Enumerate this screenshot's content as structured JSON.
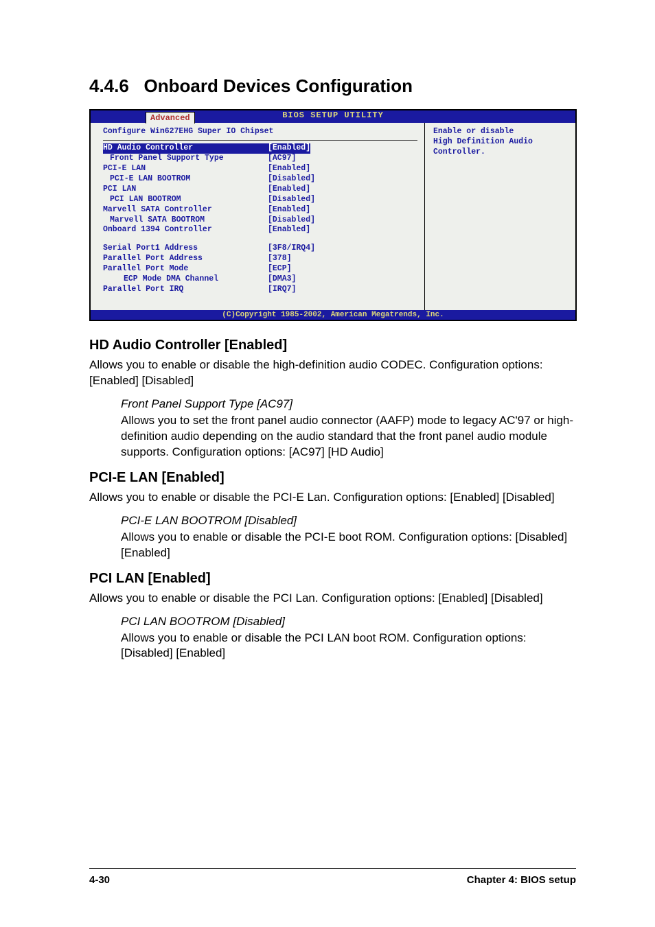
{
  "sectionNumber": "4.4.6",
  "sectionTitle": "Onboard Devices Configuration",
  "bios": {
    "headerTitle": "BIOS SETUP UTILITY",
    "tab": "Advanced",
    "chipsetLine": "Configure Win627EHG Super IO Chipset",
    "help1": "Enable or disable",
    "help2": "High Definition Audio Controller.",
    "rows": [
      {
        "label": "HD Audio Controller",
        "val": "[Enabled]",
        "sel": true
      },
      {
        "label": "Front Panel Support Type",
        "val": "[AC97]",
        "indent": 1
      },
      {
        "label": "PCI-E LAN",
        "val": "[Enabled]"
      },
      {
        "label": "PCI-E LAN BOOTROM",
        "val": "[Disabled]",
        "indent": 1
      },
      {
        "label": "PCI LAN",
        "val": "[Enabled]"
      },
      {
        "label": "PCI LAN BOOTROM",
        "val": "[Disabled]",
        "indent": 1
      },
      {
        "label": "Marvell SATA Controller",
        "val": "[Enabled]"
      },
      {
        "label": "Marvell SATA BOOTROM",
        "val": "[Disabled]",
        "indent": 1
      },
      {
        "label": "Onboard 1394 Controller",
        "val": "[Enabled]"
      }
    ],
    "rows2": [
      {
        "label": "Serial Port1 Address",
        "val": "[3F8/IRQ4]"
      },
      {
        "label": "Parallel Port Address",
        "val": "[378]"
      },
      {
        "label": "Parallel Port Mode",
        "val": "[ECP]"
      },
      {
        "label": "ECP Mode DMA Channel",
        "val": "[DMA3]",
        "indent": 2
      },
      {
        "label": "Parallel Port IRQ",
        "val": "[IRQ7]"
      }
    ],
    "footer": "(C)Copyright 1985-2002, American Megatrends, Inc."
  },
  "sections": [
    {
      "heading": "HD Audio Controller [Enabled]",
      "body": "Allows you to enable or disable the high-definition audio CODEC. Configuration options: [Enabled] [Disabled]",
      "sub": {
        "title": "Front Panel Support Type [AC97]",
        "body": "Allows you to set the front panel audio connector (AAFP) mode to legacy AC'97 or high-definition audio depending on the audio standard that the front panel audio module supports. Configuration options: [AC97] [HD Audio]"
      }
    },
    {
      "heading": "PCI-E LAN [Enabled]",
      "body": "Allows you to enable or disable the PCI-E Lan. Configuration options: [Enabled] [Disabled]",
      "sub": {
        "title": "PCI-E LAN BOOTROM [Disabled]",
        "body": "Allows you to enable or disable the PCI-E boot ROM. Configuration options: [Disabled] [Enabled]"
      }
    },
    {
      "heading": "PCI LAN [Enabled]",
      "body": "Allows you to enable or disable the PCI Lan. Configuration options: [Enabled] [Disabled]",
      "sub": {
        "title": "PCI LAN BOOTROM [Disabled]",
        "body": "Allows you to enable or disable the PCI LAN boot ROM. Configuration options: [Disabled] [Enabled]"
      }
    }
  ],
  "footer": {
    "left": "4-30",
    "right": "Chapter 4: BIOS setup"
  }
}
